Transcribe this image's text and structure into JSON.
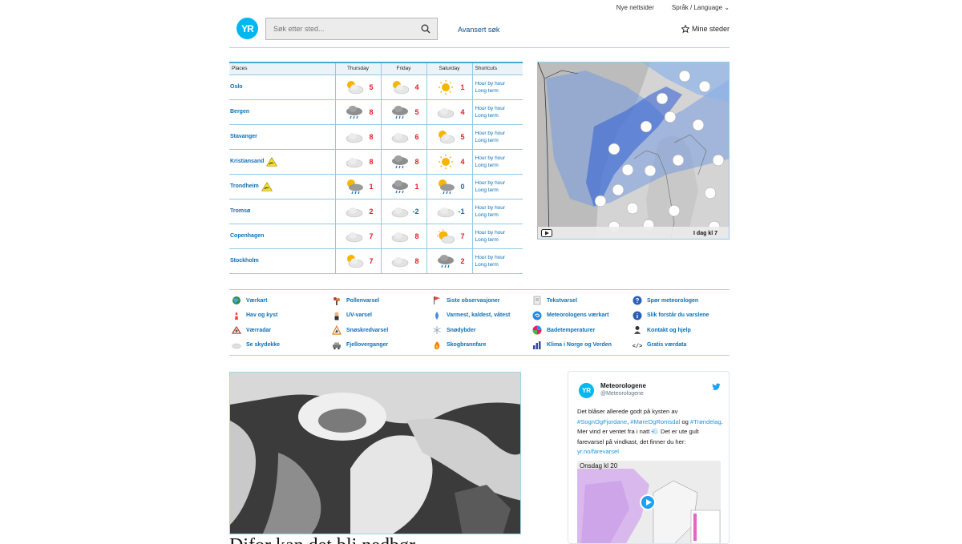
{
  "header": {
    "top_links": [
      "Nye nettsider",
      "Språk / Language"
    ],
    "logo_text": "YR",
    "search_placeholder": "Søk etter sted...",
    "advanced_search": "Avansert søk",
    "my_places": "Mine steder"
  },
  "forecast_table": {
    "columns": [
      "Places",
      "Thursday",
      "Friday",
      "Saturday",
      "Shortcuts"
    ],
    "shortcut_labels": [
      "Hour by hour",
      "Long term"
    ],
    "rows": [
      {
        "place": "Oslo",
        "warning": false,
        "days": [
          {
            "icon": "partly-cloudy-icon",
            "temp": "5"
          },
          {
            "icon": "partly-cloudy-icon",
            "temp": "4"
          },
          {
            "icon": "sun-icon",
            "temp": "1"
          }
        ]
      },
      {
        "place": "Bergen",
        "warning": false,
        "days": [
          {
            "icon": "rain-cloud-icon",
            "temp": "8"
          },
          {
            "icon": "rain-cloud-icon",
            "temp": "5"
          },
          {
            "icon": "cloud-icon",
            "temp": "4"
          }
        ]
      },
      {
        "place": "Stavanger",
        "warning": false,
        "days": [
          {
            "icon": "cloud-icon",
            "temp": "8"
          },
          {
            "icon": "cloud-icon",
            "temp": "6"
          },
          {
            "icon": "partly-cloudy-icon",
            "temp": "5"
          }
        ]
      },
      {
        "place": "Kristiansand",
        "warning": true,
        "days": [
          {
            "icon": "cloud-icon",
            "temp": "8"
          },
          {
            "icon": "rain-cloud-icon",
            "temp": "8"
          },
          {
            "icon": "sun-icon",
            "temp": "4"
          }
        ]
      },
      {
        "place": "Trondheim",
        "warning": true,
        "days": [
          {
            "icon": "partly-cloudy-rain-icon",
            "temp": "1"
          },
          {
            "icon": "rain-cloud-icon",
            "temp": "1"
          },
          {
            "icon": "partly-cloudy-rain-icon",
            "temp": "0"
          }
        ]
      },
      {
        "place": "Tromsø",
        "warning": false,
        "days": [
          {
            "icon": "cloud-icon",
            "temp": "2"
          },
          {
            "icon": "cloud-icon",
            "temp": "-2"
          },
          {
            "icon": "cloud-icon",
            "temp": "-1"
          }
        ]
      },
      {
        "place": "Copenhagen",
        "warning": false,
        "days": [
          {
            "icon": "cloud-icon",
            "temp": "7"
          },
          {
            "icon": "cloud-icon",
            "temp": "8"
          },
          {
            "icon": "sun-cloud-icon",
            "temp": "7"
          }
        ]
      },
      {
        "place": "Stockholm",
        "warning": false,
        "days": [
          {
            "icon": "partly-cloudy-icon",
            "temp": "7"
          },
          {
            "icon": "cloud-icon",
            "temp": "8"
          },
          {
            "icon": "rain-cloud-icon",
            "temp": "2"
          }
        ]
      }
    ]
  },
  "map": {
    "caption": "I dag kl 7"
  },
  "links": [
    {
      "label": "Værkart",
      "icon": "globe-icon"
    },
    {
      "label": "Pollenvarsel",
      "icon": "pollen-icon"
    },
    {
      "label": "Siste observasjoner",
      "icon": "flag-icon"
    },
    {
      "label": "Tekstvarsel",
      "icon": "document-icon"
    },
    {
      "label": "Spør meteorologen",
      "icon": "question-icon"
    },
    {
      "label": "Hav og kyst",
      "icon": "lighthouse-icon"
    },
    {
      "label": "UV-varsel",
      "icon": "uv-icon"
    },
    {
      "label": "Varmest, kaldest, våtest",
      "icon": "drop-icon"
    },
    {
      "label": "Meteorologens værkart",
      "icon": "swirl-icon"
    },
    {
      "label": "Slik forstår du varslene",
      "icon": "info-icon"
    },
    {
      "label": "Værradar",
      "icon": "radar-icon"
    },
    {
      "label": "Snøskredvarsel",
      "icon": "avalanche-icon"
    },
    {
      "label": "Snødybder",
      "icon": "snowflake-icon"
    },
    {
      "label": "Badetemperaturer",
      "icon": "beach-ball-icon"
    },
    {
      "label": "Kontakt og hjelp",
      "icon": "person-icon"
    },
    {
      "label": "Se skydekke",
      "icon": "cloud-icon"
    },
    {
      "label": "Fjelloverganger",
      "icon": "car-icon"
    },
    {
      "label": "Skogbrannfare",
      "icon": "fire-icon"
    },
    {
      "label": "Klima i Norge og Verden",
      "icon": "bar-chart-icon"
    },
    {
      "label": "Gratis værdata",
      "icon": "code-icon"
    }
  ],
  "article": {
    "headline": "Difor kan det bli nedbør"
  },
  "tweet": {
    "avatar_text": "YR",
    "name": "Meteorologene",
    "handle": "@Meteorologene",
    "text_1": "Det blåser allerede godt på kysten av ",
    "tag_1": "#SognOgFjordane",
    "sep_1": ", ",
    "tag_2": "#MøreOgRomsdal",
    "text_2": " og ",
    "tag_3": "#Trøndelag",
    "text_3": ". Mer vind er ventet fra i natt 💨 Det er ute gult farevarsel på vindkast, det finner du her: ",
    "link": "yr.no/farevarsel",
    "image_label": "Onsdag kl 20"
  }
}
